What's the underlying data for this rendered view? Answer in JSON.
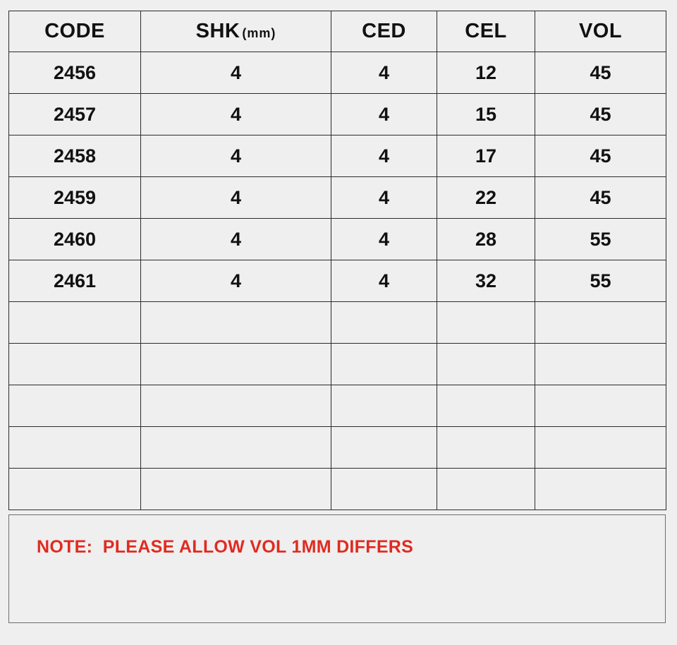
{
  "theme": {
    "page_background": "#efefef",
    "header_fill": "#e6dc1e",
    "grid_line": "#2b2b2b",
    "note_border": "#6d6d6d",
    "note_text_color": "#e02b20",
    "text_color": "#111111"
  },
  "table": {
    "columns": [
      {
        "key": "code",
        "label": "CODE",
        "unit": ""
      },
      {
        "key": "shk",
        "label": "SHK",
        "unit": "(mm)"
      },
      {
        "key": "ced",
        "label": "CED",
        "unit": ""
      },
      {
        "key": "cel",
        "label": "CEL",
        "unit": ""
      },
      {
        "key": "vol",
        "label": "VOL",
        "unit": ""
      }
    ],
    "rows": [
      {
        "code": "2456",
        "shk": "4",
        "ced": "4",
        "cel": "12",
        "vol": "45"
      },
      {
        "code": "2457",
        "shk": "4",
        "ced": "4",
        "cel": "15",
        "vol": "45"
      },
      {
        "code": "2458",
        "shk": "4",
        "ced": "4",
        "cel": "17",
        "vol": "45"
      },
      {
        "code": "2459",
        "shk": "4",
        "ced": "4",
        "cel": "22",
        "vol": "45"
      },
      {
        "code": "2460",
        "shk": "4",
        "ced": "4",
        "cel": "28",
        "vol": "55"
      },
      {
        "code": "2461",
        "shk": "4",
        "ced": "4",
        "cel": "32",
        "vol": "55"
      },
      {
        "code": "",
        "shk": "",
        "ced": "",
        "cel": "",
        "vol": ""
      },
      {
        "code": "",
        "shk": "",
        "ced": "",
        "cel": "",
        "vol": ""
      },
      {
        "code": "",
        "shk": "",
        "ced": "",
        "cel": "",
        "vol": ""
      },
      {
        "code": "",
        "shk": "",
        "ced": "",
        "cel": "",
        "vol": ""
      },
      {
        "code": "",
        "shk": "",
        "ced": "",
        "cel": "",
        "vol": ""
      }
    ],
    "empty_row_count": 5,
    "filled_row_count": 6
  },
  "note": {
    "text": "NOTE:  PLEASE ALLOW VOL 1MM DIFFERS"
  }
}
